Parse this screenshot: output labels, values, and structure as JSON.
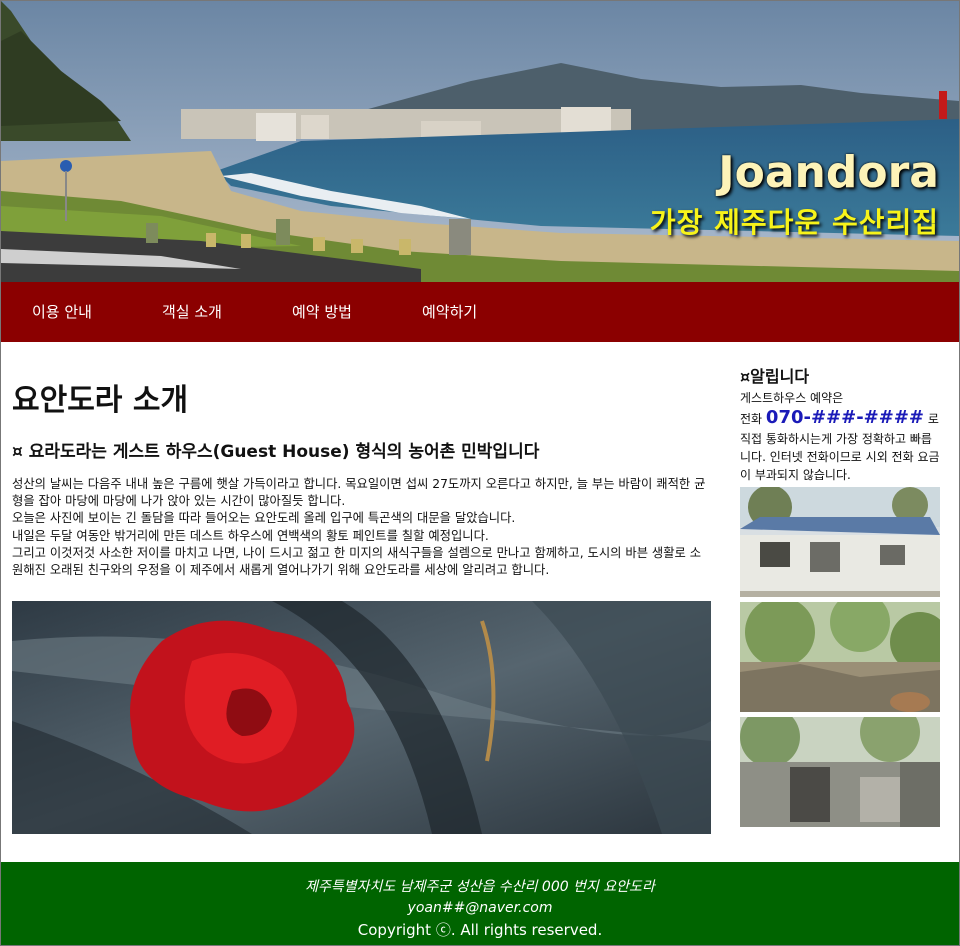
{
  "header": {
    "brand_title": "Joandora",
    "brand_subtitle": "가장 제주다운 수산리집"
  },
  "nav": {
    "items": [
      {
        "label": "이용 안내"
      },
      {
        "label": "객실 소개"
      },
      {
        "label": "예약 방법"
      },
      {
        "label": "예약하기"
      }
    ]
  },
  "main": {
    "title": "요안도라 소개",
    "subtitle": "¤ 요라도라는 게스트 하우스(Guest House) 형식의 농어촌 민박입니다",
    "paragraphs": [
      "성산의 날씨는 다음주 내내 높은 구름에 햇살 가득이라고 합니다. 목요일이면 섭씨 27도까지 오른다고 하지만, 늘 부는 바람이 쾌적한 균형을 잡아 마당에 마당에 나가 앉아 있는 시간이 많아질듯 합니다.",
      "오늘은 사진에 보이는 긴 돌담을 따라 들어오는 요안도레 올레 입구에 특곤색의 대문을 달았습니다.",
      "내일은 두달 여동안 밖거리에 만든 데스트 하우스에 연백색의 황토 페인트를 칠할 예정입니다.",
      "그리고 이것저것 사소한 저이를 마치고 나면, 나이 드시고 젊고 한 미지의 새식구들을 설렘으로 만나고 함께하고, 도시의 바븐 생활로 소원해진 오래된 친구와의 우정을 이 제주에서 새롭게 열어나가기 위해 요안도라를 세상에 알리려고 합니다."
    ]
  },
  "sidebar": {
    "title": "¤알립니다",
    "intro": "게스트하우스 예약은",
    "phone_prefix": "전화",
    "phone": "070-###-####",
    "phone_suffix": "로",
    "note": "직접 통화하시는게 가장 정확하고 빠릅니다. 인터넷 전화이므로 시외 전화 요금이 부과되지 않습니다."
  },
  "footer": {
    "address": "제주특별자치도 남제주군 성산읍 수산리 000 번지 요안도라",
    "email": "yoan##@naver.com",
    "copyright": "Copyright ⓒ. All rights reserved."
  },
  "colors": {
    "nav_bg": "#8b0000",
    "footer_bg": "#006400",
    "brand_title": "#fdf3b8",
    "brand_subtitle": "#f7f31a",
    "phone": "#1a1ab8"
  }
}
